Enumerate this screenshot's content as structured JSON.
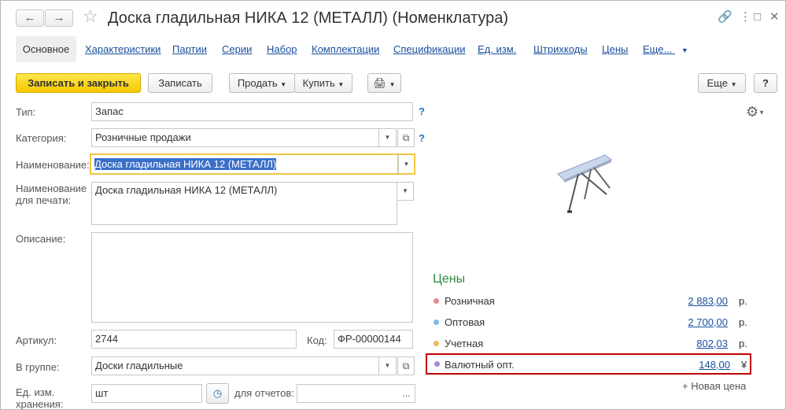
{
  "window": {
    "title": "Доска гладильная  НИКА 12 (МЕТАЛЛ) (Номенклатура)"
  },
  "tabs": {
    "active": "Основное",
    "items": [
      "Характеристики",
      "Партии",
      "Серии",
      "Набор",
      "Комплектации",
      "Спецификации",
      "Ед. изм.",
      "Штрихкоды",
      "Цены",
      "Еще..."
    ]
  },
  "toolbar": {
    "save_close": "Записать и закрыть",
    "save": "Записать",
    "sell": "Продать",
    "buy": "Купить",
    "more": "Еще",
    "help": "?"
  },
  "form": {
    "type_label": "Тип:",
    "type_value": "Запас",
    "category_label": "Категория:",
    "category_value": "Розничные продажи",
    "name_label": "Наименование:",
    "name_value": "Доска гладильная  НИКА 12 (МЕТАЛЛ)",
    "print_name_label_1": "Наименование",
    "print_name_label_2": "для печати:",
    "print_name_value": "Доска гладильная  НИКА 12 (МЕТАЛЛ)",
    "description_label": "Описание:",
    "article_label": "Артикул:",
    "article_value": "2744",
    "code_label": "Код:",
    "code_value": "ФР-00000144",
    "group_label": "В группе:",
    "group_value": "Доски гладильные",
    "unit_label_1": "Ед. изм.",
    "unit_label_2": "хранения:",
    "unit_value": "шт",
    "reports_label": "для отчетов:",
    "reports_value": "",
    "help_mark": "?"
  },
  "prices": {
    "title": "Цены",
    "items": [
      {
        "name": "Розничная",
        "value": "2 883,00",
        "currency": "р.",
        "color": "#e88a8a"
      },
      {
        "name": "Оптовая",
        "value": "2 700,00",
        "currency": "р.",
        "color": "#7fb8e6"
      },
      {
        "name": "Учетная",
        "value": "802,03",
        "currency": "р.",
        "color": "#f0b860"
      },
      {
        "name": "Валютный опт.",
        "value": "148,00",
        "currency": "¥",
        "color": "#a98ad8"
      }
    ],
    "new_price": "+ Новая цена"
  },
  "colors": {
    "accent_yellow": "#f5c800",
    "link": "#1a4f9c",
    "highlight": "#c00000",
    "prices_title": "#2e8b3f"
  }
}
